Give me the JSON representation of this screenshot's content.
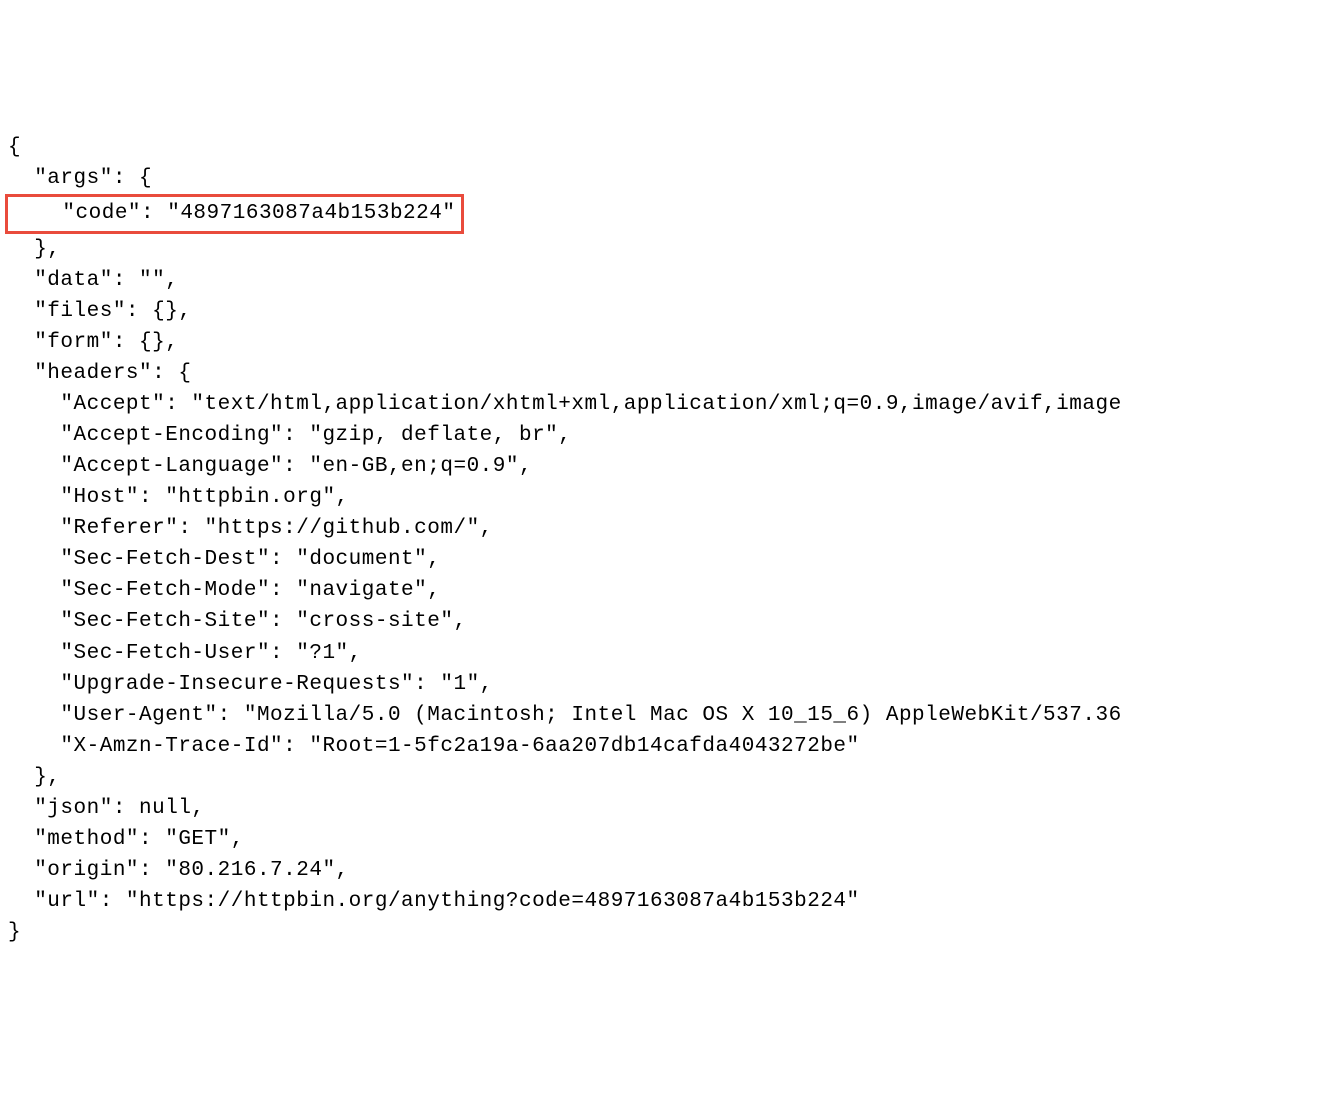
{
  "json_response": {
    "args": {
      "code": "4897163087a4b153b224"
    },
    "data": "",
    "files": {},
    "form": {},
    "headers": {
      "Accept": "text/html,application/xhtml+xml,application/xml;q=0.9,image/avif,image",
      "Accept-Encoding": "gzip, deflate, br",
      "Accept-Language": "en-GB,en;q=0.9",
      "Host": "httpbin.org",
      "Referer": "https://github.com/",
      "Sec-Fetch-Dest": "document",
      "Sec-Fetch-Mode": "navigate",
      "Sec-Fetch-Site": "cross-site",
      "Sec-Fetch-User": "?1",
      "Upgrade-Insecure-Requests": "1",
      "User-Agent": "Mozilla/5.0 (Macintosh; Intel Mac OS X 10_15_6) AppleWebKit/537.36",
      "X-Amzn-Trace-Id": "Root=1-5fc2a19a-6aa207db14cafda4043272be"
    },
    "json": null,
    "method": "GET",
    "origin": "80.216.7.24",
    "url": "https://httpbin.org/anything?code=4897163087a4b153b224"
  },
  "lines": {
    "l1": "{",
    "l2": "  \"args\": {",
    "l3": "    \"code\": \"4897163087a4b153b224\"",
    "l4": "  },",
    "l5": "  \"data\": \"\",",
    "l6": "  \"files\": {},",
    "l7": "  \"form\": {},",
    "l8": "  \"headers\": {",
    "l9": "    \"Accept\": \"text/html,application/xhtml+xml,application/xml;q=0.9,image/avif,image",
    "l10": "    \"Accept-Encoding\": \"gzip, deflate, br\",",
    "l11": "    \"Accept-Language\": \"en-GB,en;q=0.9\",",
    "l12": "    \"Host\": \"httpbin.org\",",
    "l13": "    \"Referer\": \"https://github.com/\",",
    "l14": "    \"Sec-Fetch-Dest\": \"document\",",
    "l15": "    \"Sec-Fetch-Mode\": \"navigate\",",
    "l16": "    \"Sec-Fetch-Site\": \"cross-site\",",
    "l17": "    \"Sec-Fetch-User\": \"?1\",",
    "l18": "    \"Upgrade-Insecure-Requests\": \"1\",",
    "l19": "    \"User-Agent\": \"Mozilla/5.0 (Macintosh; Intel Mac OS X 10_15_6) AppleWebKit/537.36",
    "l20": "    \"X-Amzn-Trace-Id\": \"Root=1-5fc2a19a-6aa207db14cafda4043272be\"",
    "l21": "  },",
    "l22": "  \"json\": null,",
    "l23": "  \"method\": \"GET\",",
    "l24": "  \"origin\": \"80.216.7.24\",",
    "l25": "  \"url\": \"https://httpbin.org/anything?code=4897163087a4b153b224\"",
    "l26": "}"
  },
  "highlight_color": "#e94b3c"
}
